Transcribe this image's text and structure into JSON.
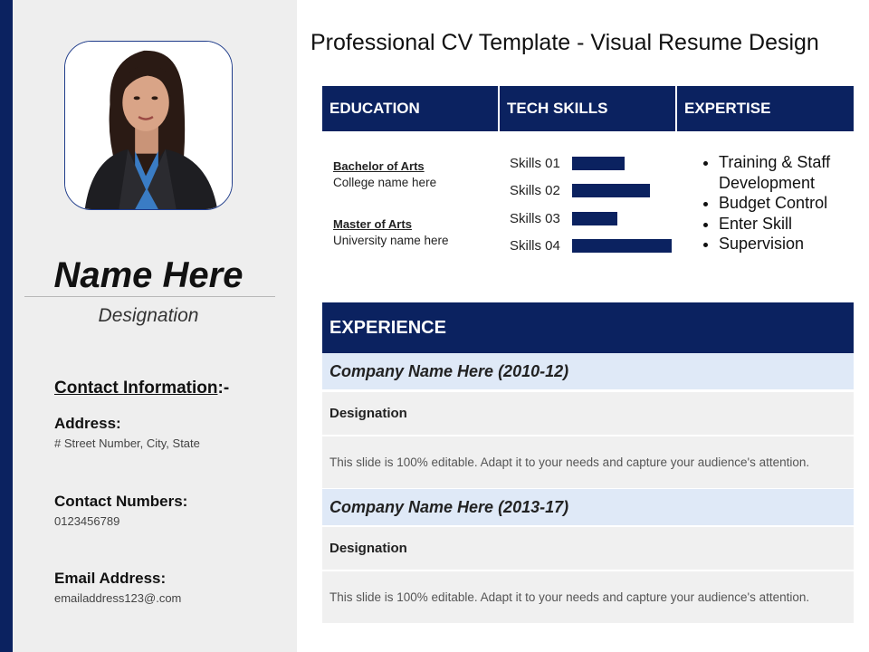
{
  "page": {
    "title": "Professional CV Template - Visual Resume Design"
  },
  "profile": {
    "name": "Name Here",
    "designation": "Designation"
  },
  "contact": {
    "heading_main": "Contact Information",
    "heading_suffix": ":-",
    "address_label": "Address:",
    "address_value": "# Street Number, City, State",
    "phone_label": "Contact Numbers:",
    "phone_value": "0123456789",
    "email_label": "Email Address:",
    "email_value": "emailaddress123@.com"
  },
  "sections": {
    "education": "EDUCATION",
    "tech_skills": "TECH SKILLS",
    "expertise": "EXPERTISE",
    "experience": "EXPERIENCE"
  },
  "education": [
    {
      "degree": "Bachelor of Arts",
      "school": "College name here"
    },
    {
      "degree": "Master of Arts",
      "school": "University name here"
    }
  ],
  "skills": [
    {
      "label": "Skills 01",
      "level": 0.53
    },
    {
      "label": "Skills 02",
      "level": 0.78
    },
    {
      "label": "Skills 03",
      "level": 0.45
    },
    {
      "label": "Skills 04",
      "level": 1.0
    }
  ],
  "expertise": [
    "Training & Staff Development",
    "Budget Control",
    "Enter Skill",
    "Supervision"
  ],
  "experience": [
    {
      "company": "Company Name Here (2010-12)",
      "designation": "Designation",
      "description": "This slide is 100% editable. Adapt it to your needs and capture your audience's attention."
    },
    {
      "company": "Company Name Here (2013-17)",
      "designation": "Designation",
      "description": "This slide is 100% editable. Adapt it to your needs and capture your audience's attention."
    }
  ],
  "colors": {
    "navy": "#0b2260",
    "panel_gray": "#eeeeee",
    "company_row": "#dfe9f7",
    "row_gray": "#f0f0f0"
  }
}
